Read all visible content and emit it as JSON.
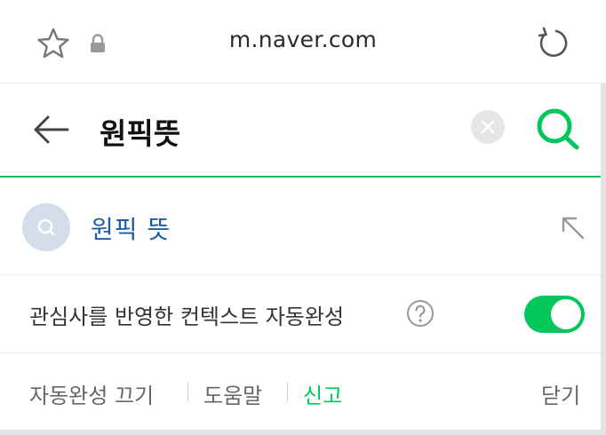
{
  "browser": {
    "url": "m.naver.com",
    "icons": [
      "star-icon",
      "lock-icon",
      "reload-icon"
    ]
  },
  "search": {
    "query": "원픽뜻",
    "icons": [
      "back-arrow-icon",
      "clear-icon",
      "search-icon"
    ]
  },
  "suggestions": [
    {
      "text": "원픽 뜻",
      "icon": "search-icon",
      "action_icon": "fill-arrow-icon"
    }
  ],
  "context": {
    "label": "관심사를 반영한 컨텍스트 자동완성",
    "help_icon": "question-circle-icon",
    "toggle_on": true
  },
  "footer": {
    "autocomplete_off": "자동완성 끄기",
    "help": "도움말",
    "report": "신고",
    "close": "닫기"
  },
  "colors": {
    "accent": "#03c75a",
    "suggestion_text": "#1f5ca8"
  }
}
